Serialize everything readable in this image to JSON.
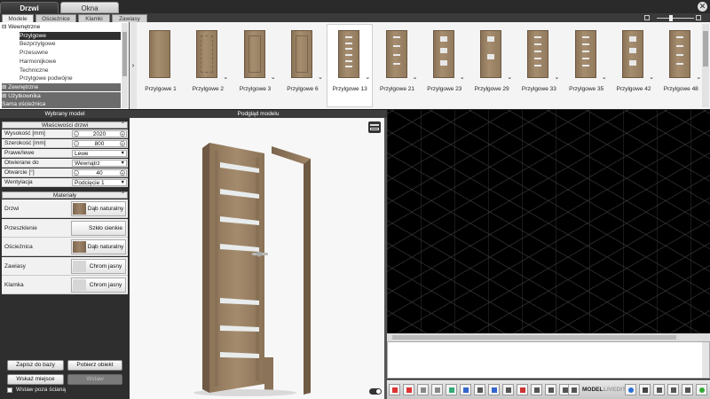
{
  "app": {
    "close_glyph": "✕",
    "main_tabs": [
      "Drzwi",
      "Okna"
    ],
    "sub_tabs": [
      "Modele",
      "Ościeżnice",
      "Klamki",
      "Zawiasy"
    ]
  },
  "tree": {
    "items": [
      {
        "label": "⊟ Wewnętrzne",
        "kind": "cat"
      },
      {
        "label": "Przylgowe",
        "kind": "child-selected"
      },
      {
        "label": "Bezprzylgowe",
        "kind": "child"
      },
      {
        "label": "Przesuwne",
        "kind": "child"
      },
      {
        "label": "Harmonijkowe",
        "kind": "child"
      },
      {
        "label": "Techniczne",
        "kind": "child"
      },
      {
        "label": "Przylgowe podwójne",
        "kind": "child"
      },
      {
        "label": "⊞ Zewnętrzne",
        "kind": "cat-dark"
      },
      {
        "label": "⊞ Użytkownika",
        "kind": "cat-dark"
      },
      {
        "label": "Sama ościeżnica",
        "kind": "cat-dark"
      }
    ]
  },
  "gallery": {
    "arrow": "›",
    "items": [
      {
        "label": "Przylgowe 1",
        "style": "plain",
        "panes": 0
      },
      {
        "label": "Przylgowe 2",
        "style": "chevron",
        "panes": 0
      },
      {
        "label": "Przylgowe 3",
        "style": "panel",
        "panes": 0
      },
      {
        "label": "Przylgowe 6",
        "style": "panel",
        "panes": 0
      },
      {
        "label": "Przylgowe 13",
        "style": "glass",
        "panes": 6,
        "selected": true
      },
      {
        "label": "Przylgowe 21",
        "style": "glass",
        "panes": 4
      },
      {
        "label": "Przylgowe 23",
        "style": "glass",
        "panes": 3
      },
      {
        "label": "Przylgowe 29",
        "style": "glass",
        "panes": 2
      },
      {
        "label": "Przylgowe 33",
        "style": "glass",
        "panes": 5
      },
      {
        "label": "Przylgowe 35",
        "style": "glass",
        "panes": 5
      },
      {
        "label": "Przylgowe 42",
        "style": "glass",
        "panes": 3
      },
      {
        "label": "Przylgowe 48",
        "style": "glass",
        "panes": 4
      }
    ]
  },
  "left_panel": {
    "title": "Wybrany model",
    "properties_header": "Właściwości drzwi",
    "properties": [
      {
        "label": "Wysokość [mm]",
        "type": "spin",
        "value": "2020"
      },
      {
        "label": "Szerokość [mm]",
        "type": "spin",
        "value": "800"
      },
      {
        "label": "Prawe/lewe",
        "type": "combo",
        "value": "Lewe"
      },
      {
        "label": "Otwierane do",
        "type": "combo",
        "value": "Wewnątrz"
      },
      {
        "label": "Otwarcie [°]",
        "type": "spin",
        "value": "40"
      },
      {
        "label": "Wentylacja",
        "type": "combo",
        "value": "Podcięcie 1"
      }
    ],
    "materials_header": "Materiały",
    "materials": [
      {
        "label": "Drzwi",
        "value": "Dąb naturalny",
        "swatch": "wood"
      },
      {
        "label": "Przeszklenie",
        "value": "Szkło cienkie",
        "swatch": "none"
      },
      {
        "label": "Ościeżnica",
        "value": "Dąb naturalny",
        "swatch": "wood"
      },
      {
        "label": "Zawiasy",
        "value": "Chrom jasny",
        "swatch": "grey"
      },
      {
        "label": "Klamka",
        "value": "Chrom jasny",
        "swatch": "grey"
      }
    ],
    "buttons": {
      "save": "Zapisz do bazy",
      "fetch": "Pobierz obiekt",
      "point": "Wskaż miejsce",
      "insert": "Wstaw"
    },
    "checkbox_label": "Wstaw poza ścianą"
  },
  "preview": {
    "title": "Podgląd modelu"
  },
  "toolbar": {
    "model_label": "MODEL",
    "label2": "LIVEDIT"
  },
  "colors": {
    "wood": "#9c8367",
    "wood_dark": "#7d6650",
    "glass": "#e9ecec",
    "selected_row": "#2e2e2e"
  }
}
